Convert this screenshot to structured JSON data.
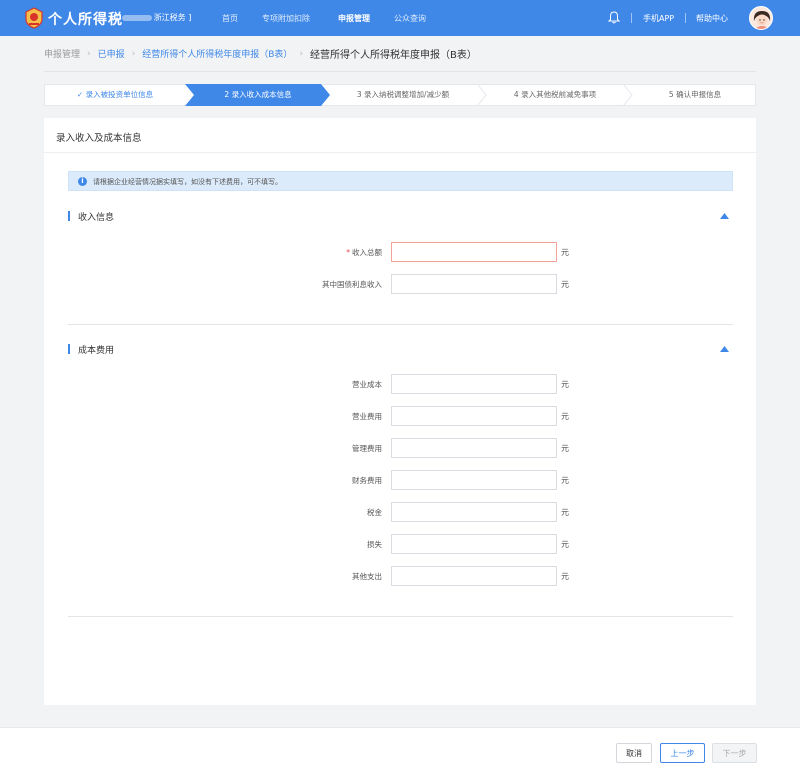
{
  "header": {
    "brand": "个人所得税",
    "org_suffix": "浙江税务 ]",
    "nav": [
      "首页",
      "专项附加扣除",
      "申报管理",
      "公众查询"
    ],
    "active_nav": "申报管理",
    "mobile_app": "手机APP",
    "help": "帮助中心"
  },
  "breadcrumb": {
    "items": [
      "申报管理",
      "已申报",
      "经营所得个人所得税年度申报（B表）",
      "经营所得个人所得税年度申报（B表）"
    ]
  },
  "steps": [
    {
      "label": "✓ 录入被投资单位信息",
      "state": "done"
    },
    {
      "label": "2 录入收入成本信息",
      "state": "active"
    },
    {
      "label": "3 录入纳税调整增加/减少额",
      "state": "todo"
    },
    {
      "label": "4 录入其他税前减免事项",
      "state": "todo"
    },
    {
      "label": "5 确认申报信息",
      "state": "todo"
    }
  ],
  "panel": {
    "title": "录入收入及成本信息",
    "notice": "请根据企业经营情况据实填写，如没有下述费用，可不填写。",
    "income_section": {
      "title": "收入信息",
      "fields": [
        {
          "label": "收入总额",
          "required": true,
          "value": "",
          "unit": "元"
        },
        {
          "label": "其中国债利息收入",
          "required": false,
          "value": "",
          "unit": "元"
        }
      ]
    },
    "cost_section": {
      "title": "成本费用",
      "fields": [
        {
          "label": "营业成本",
          "value": "",
          "unit": "元"
        },
        {
          "label": "营业费用",
          "value": "",
          "unit": "元"
        },
        {
          "label": "管理费用",
          "value": "",
          "unit": "元"
        },
        {
          "label": "财务费用",
          "value": "",
          "unit": "元"
        },
        {
          "label": "税金",
          "value": "",
          "unit": "元"
        },
        {
          "label": "损失",
          "value": "",
          "unit": "元"
        },
        {
          "label": "其他支出",
          "value": "",
          "unit": "元"
        }
      ]
    }
  },
  "footer": {
    "cancel": "取消",
    "prev": "上一步",
    "next": "下一步"
  },
  "colors": {
    "primary": "#3f88e8",
    "required": "#e5484d"
  }
}
